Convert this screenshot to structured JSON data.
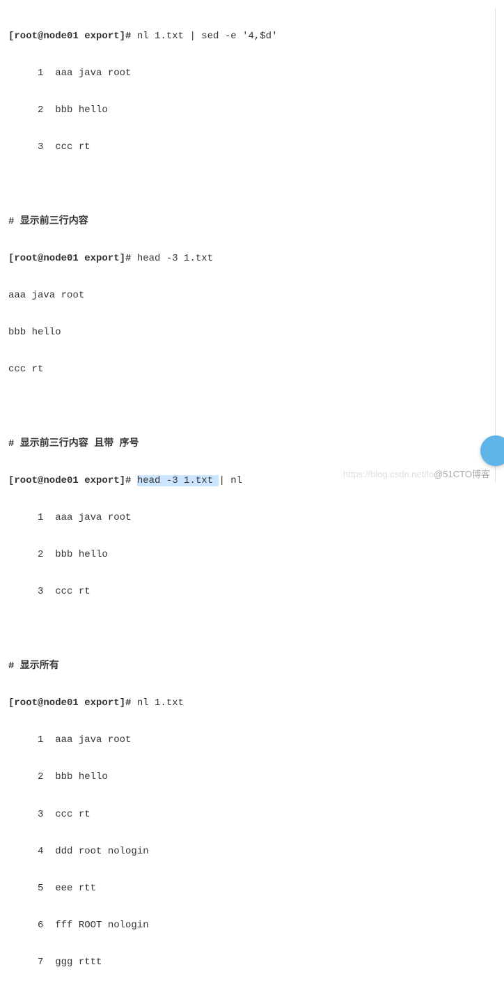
{
  "block1": {
    "cmd_prompt": "[root@node01 export]#",
    "cmd": " nl 1.txt | sed -e '4,$d'",
    "out": [
      "     1  aaa java root",
      "     2  bbb hello",
      "     3  ccc rt"
    ]
  },
  "block2": {
    "comment": "# 显示前三行内容",
    "cmd_prompt": "[root@node01 export]#",
    "cmd": " head -3 1.txt",
    "out": [
      "aaa java root",
      "bbb hello",
      "ccc rt"
    ]
  },
  "block3": {
    "comment": "# 显示前三行内容 且带 序号",
    "cmd_prompt": "[root@node01 export]#",
    "cmd_part1": " ",
    "cmd_highlight": "head -3 1.txt ",
    "cmd_part2": "| nl",
    "out": [
      "     1  aaa java root",
      "     2  bbb hello",
      "     3  ccc rt"
    ]
  },
  "block4": {
    "comment": "# 显示所有",
    "cmd_prompt": "[root@node01 export]#",
    "cmd": " nl 1.txt",
    "out": [
      "     1  aaa java root",
      "     2  bbb hello",
      "     3  ccc rt",
      "     4  ddd root nologin",
      "     5  eee rtt",
      "     6  fff ROOT nologin",
      "     7  ggg rttt"
    ]
  },
  "watermark": {
    "left": "https://blog.csdn.net/lo",
    "right": "@51CTO博客"
  }
}
